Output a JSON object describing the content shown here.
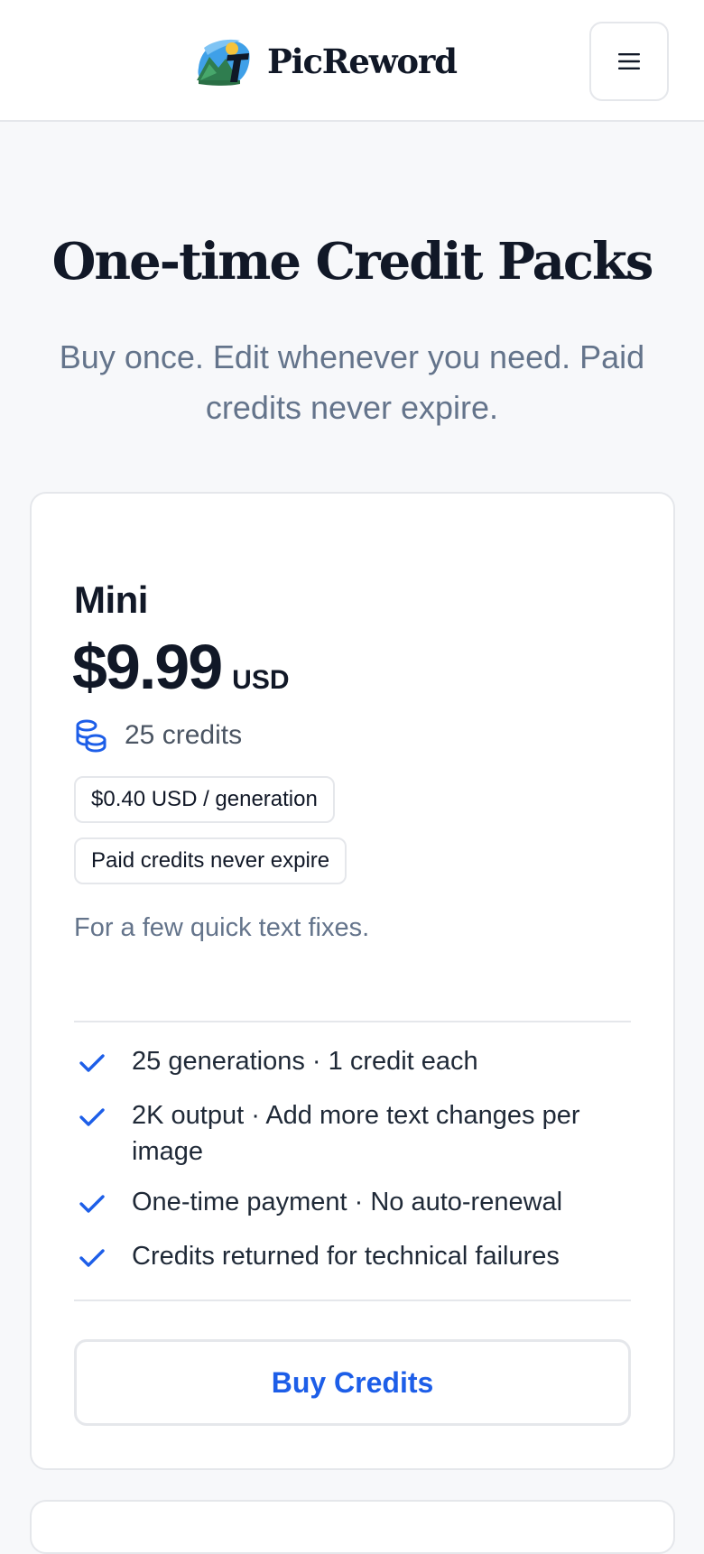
{
  "brand": {
    "name": "PicReword",
    "logo_icon": "picreword-logo-icon"
  },
  "header": {
    "menu_icon": "hamburger-menu-icon"
  },
  "hero": {
    "title": "One-time Credit Packs",
    "subtitle": "Buy once. Edit whenever you need. Paid credits never expire."
  },
  "pack": {
    "name": "Mini",
    "price": "$9.99",
    "currency": "USD",
    "credits_icon": "coins-icon",
    "credits": "25 credits",
    "tags": [
      "$0.40 USD / generation",
      "Paid credits never expire"
    ],
    "description": "For a few quick text fixes.",
    "features": [
      "25 generations · 1 credit each",
      "2K output · Add more text changes per image",
      "One-time payment · No auto-renewal",
      "Credits returned for technical failures"
    ],
    "feature_icon": "check-icon",
    "buy_label": "Buy Credits"
  },
  "colors": {
    "accent": "#1d5ee8",
    "text_primary": "#111827",
    "text_muted": "#64748b",
    "border": "#e5e7eb",
    "background": "#f7f8fa"
  }
}
